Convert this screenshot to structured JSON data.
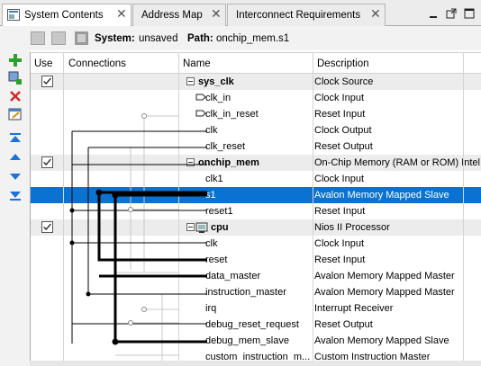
{
  "tabs": [
    {
      "label": "System Contents",
      "active": true
    },
    {
      "label": "Address Map",
      "active": false
    },
    {
      "label": "Interconnect Requirements",
      "active": false
    }
  ],
  "toolbar": {
    "system_label": "System:",
    "system_value": "unsaved",
    "path_label": "Path:",
    "path_value": "onchip_mem.s1"
  },
  "table": {
    "headers": {
      "use": "Use",
      "connections": "Connections",
      "name": "Name",
      "description": "Description"
    },
    "rows": [
      {
        "name": "sys_clk",
        "desc": "Clock Source",
        "group": true,
        "checked": true
      },
      {
        "name": "clk_in",
        "desc": "Clock Input"
      },
      {
        "name": "clk_in_reset",
        "desc": "Reset Input"
      },
      {
        "name": "clk",
        "desc": "Clock Output"
      },
      {
        "name": "clk_reset",
        "desc": "Reset Output"
      },
      {
        "name": "onchip_mem",
        "desc": "On-Chip Memory (RAM or ROM) Intel",
        "group": true,
        "checked": true
      },
      {
        "name": "clk1",
        "desc": "Clock Input"
      },
      {
        "name": "s1",
        "desc": "Avalon Memory Mapped Slave",
        "selected": true
      },
      {
        "name": "reset1",
        "desc": "Reset Input"
      },
      {
        "name": "cpu",
        "desc": "Nios II Processor",
        "group": true,
        "checked": true,
        "icon": true
      },
      {
        "name": "clk",
        "desc": "Clock Input"
      },
      {
        "name": "reset",
        "desc": "Reset Input"
      },
      {
        "name": "data_master",
        "desc": "Avalon Memory Mapped Master"
      },
      {
        "name": "instruction_master",
        "desc": "Avalon Memory Mapped Master"
      },
      {
        "name": "irq",
        "desc": "Interrupt Receiver"
      },
      {
        "name": "debug_reset_request",
        "desc": "Reset Output"
      },
      {
        "name": "debug_mem_slave",
        "desc": "Avalon Memory Mapped Slave"
      },
      {
        "name": "custom_instruction_m...",
        "desc": "Custom Instruction Master"
      }
    ]
  },
  "colors": {
    "selection": "#0a73d1",
    "group_bg": "#ececec",
    "add_green": "#2ca02c",
    "remove_red": "#d62728",
    "move_blue": "#1a73d9"
  }
}
